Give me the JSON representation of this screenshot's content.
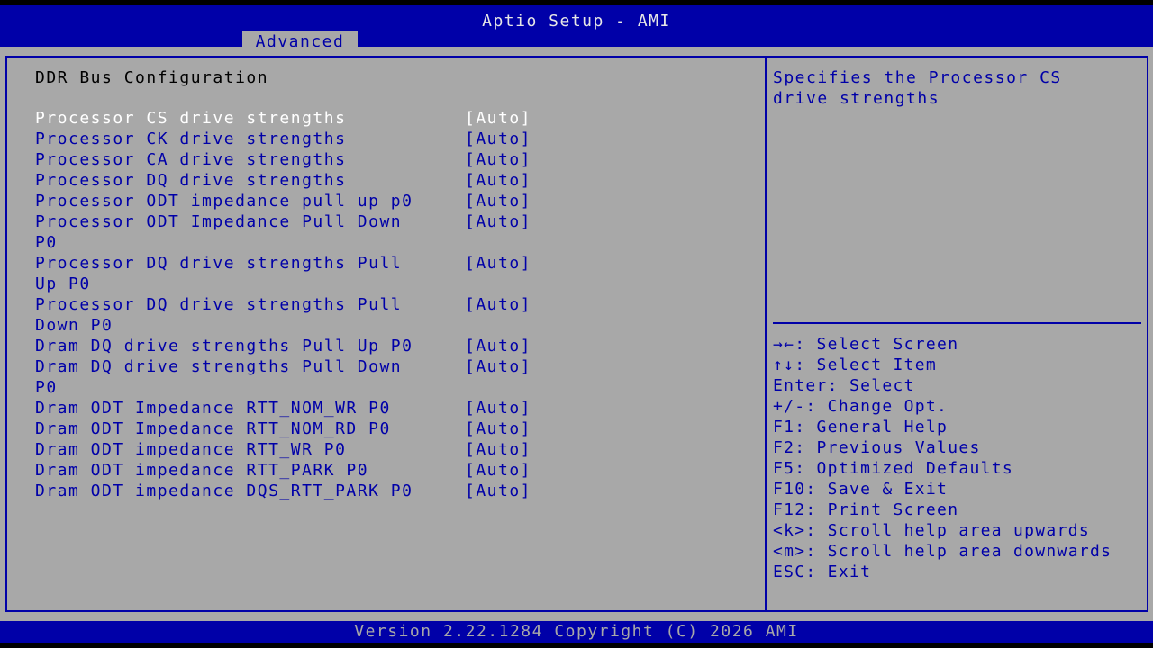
{
  "header": {
    "title": "Aptio Setup - AMI",
    "active_tab": "Advanced"
  },
  "section": {
    "title": "DDR Bus Configuration"
  },
  "settings": [
    {
      "label": "Processor CS drive strengths",
      "value": "[Auto]",
      "selected": true
    },
    {
      "label": "Processor CK drive strengths",
      "value": "[Auto]"
    },
    {
      "label": "Processor CA drive strengths",
      "value": "[Auto]"
    },
    {
      "label": "Processor DQ drive strengths",
      "value": "[Auto]"
    },
    {
      "label": "Processor ODT impedance pull up p0",
      "value": "[Auto]"
    },
    {
      "label": "Processor ODT Impedance Pull Down\nP0",
      "value": "[Auto]"
    },
    {
      "label": "Processor DQ drive strengths Pull\nUp P0",
      "value": "[Auto]"
    },
    {
      "label": "Processor DQ drive strengths Pull\nDown P0",
      "value": "[Auto]"
    },
    {
      "label": "Dram DQ drive strengths Pull Up P0",
      "value": "[Auto]"
    },
    {
      "label": "Dram DQ drive strengths Pull Down\nP0",
      "value": "[Auto]"
    },
    {
      "label": "Dram ODT Impedance RTT_NOM_WR P0",
      "value": "[Auto]"
    },
    {
      "label": "Dram ODT Impedance RTT_NOM_RD P0",
      "value": "[Auto]"
    },
    {
      "label": "Dram ODT impedance RTT_WR P0",
      "value": "[Auto]"
    },
    {
      "label": "Dram ODT impedance RTT_PARK P0",
      "value": "[Auto]"
    },
    {
      "label": "Dram ODT impedance DQS_RTT_PARK P0",
      "value": "[Auto]"
    }
  ],
  "help": {
    "text": "Specifies the Processor CS\ndrive strengths"
  },
  "keys": [
    "→←: Select Screen",
    "↑↓: Select Item",
    "Enter: Select",
    "+/-: Change Opt.",
    "F1: General Help",
    "F2: Previous Values",
    "F5: Optimized Defaults",
    "F10: Save & Exit",
    "F12: Print Screen",
    "<k>: Scroll help area upwards",
    "<m>: Scroll help area downwards",
    "ESC: Exit"
  ],
  "footer": {
    "version": "Version 2.22.1284 Copyright (C) 2026 AMI"
  },
  "colors": {
    "background": "#a8a8a8",
    "bar": "#0000a8",
    "text": "#0000a8",
    "selected": "#ffffff"
  }
}
